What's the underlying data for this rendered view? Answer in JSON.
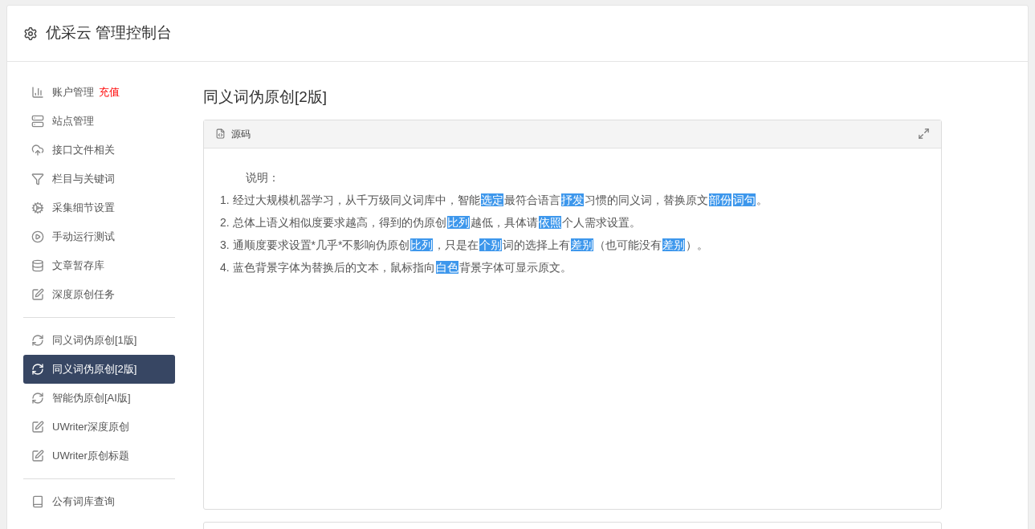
{
  "header": {
    "title": "优采云 管理控制台"
  },
  "sidebar": {
    "groups": [
      {
        "items": [
          {
            "label": "账户管理",
            "badge": "充值",
            "selected": false
          },
          {
            "label": "站点管理",
            "selected": false
          },
          {
            "label": "接口文件相关",
            "selected": false
          },
          {
            "label": "栏目与关键词",
            "selected": false
          },
          {
            "label": "采集细节设置",
            "selected": false
          },
          {
            "label": "手动运行测试",
            "selected": false
          },
          {
            "label": "文章暂存库",
            "selected": false
          },
          {
            "label": "深度原创任务",
            "selected": false
          }
        ]
      },
      {
        "items": [
          {
            "label": "同义词伪原创[1版]",
            "selected": false
          },
          {
            "label": "同义词伪原创[2版]",
            "selected": true
          },
          {
            "label": "智能伪原创[AI版]",
            "selected": false
          },
          {
            "label": "UWriter深度原创",
            "selected": false
          },
          {
            "label": "UWriter原创标题",
            "selected": false
          }
        ]
      },
      {
        "items": [
          {
            "label": "公有词库查询",
            "selected": false
          }
        ]
      }
    ]
  },
  "content": {
    "title": "同义词伪原创[2版]",
    "editor": {
      "tab": "源码",
      "heading": "说明：",
      "lines": [
        [
          {
            "text": "1. 经过大规模机器学习，从千万级同义词库中，智能",
            "highlight": false
          },
          {
            "text": "选定",
            "highlight": true
          },
          {
            "text": "最符合语言",
            "highlight": false
          },
          {
            "text": "抒发",
            "highlight": true
          },
          {
            "text": "习惯的同义词，替换原文",
            "highlight": false
          },
          {
            "text": "部份",
            "highlight": true
          },
          {
            "text": "词句",
            "highlight": true
          },
          {
            "text": "。",
            "highlight": false
          }
        ],
        [
          {
            "text": "2. 总体上语义相似度要求越高，得到的伪原创",
            "highlight": false
          },
          {
            "text": "比列",
            "highlight": true
          },
          {
            "text": "越低，具体请",
            "highlight": false
          },
          {
            "text": "依照",
            "highlight": true
          },
          {
            "text": "个人需求设置。",
            "highlight": false
          }
        ],
        [
          {
            "text": "3. 通顺度要求设置*几乎*不影响伪原创",
            "highlight": false
          },
          {
            "text": "比列",
            "highlight": true
          },
          {
            "text": "，只是在",
            "highlight": false
          },
          {
            "text": "个别",
            "highlight": true
          },
          {
            "text": "词的选择上有",
            "highlight": false
          },
          {
            "text": "差别",
            "highlight": true
          },
          {
            "text": "（也可能没有",
            "highlight": false
          },
          {
            "text": "差别",
            "highlight": true
          },
          {
            "text": "）。",
            "highlight": false
          }
        ],
        [
          {
            "text": "4. 蓝色背景字体为替换后的文本，鼠标指向",
            "highlight": false
          },
          {
            "text": "白色",
            "highlight": true
          },
          {
            "text": "背景字体可显示原文。",
            "highlight": false
          }
        ]
      ]
    }
  }
}
